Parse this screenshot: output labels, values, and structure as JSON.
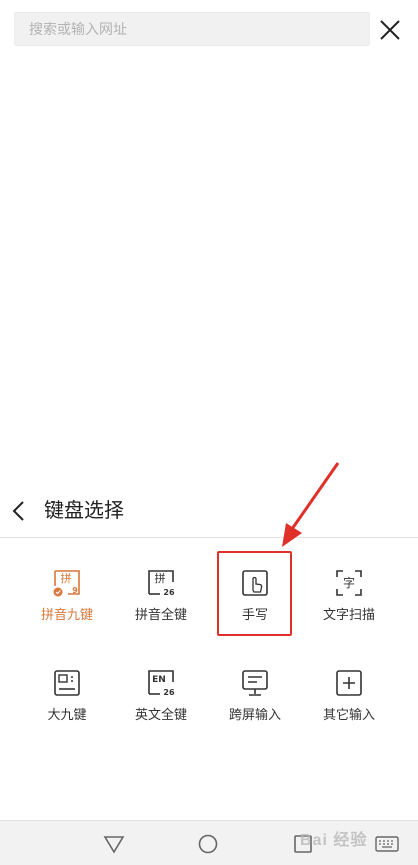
{
  "search": {
    "placeholder": "搜索或输入网址"
  },
  "panel": {
    "title": "键盘选择"
  },
  "keyboards": [
    {
      "label": "拼音九键",
      "icon": "pinyin-nine-key-icon",
      "selected": true
    },
    {
      "label": "拼音全键",
      "icon": "pinyin-full-key-icon",
      "selected": false
    },
    {
      "label": "手写",
      "icon": "handwriting-icon",
      "selected": false
    },
    {
      "label": "文字扫描",
      "icon": "text-scan-icon",
      "selected": false
    },
    {
      "label": "大九键",
      "icon": "big-nine-key-icon",
      "selected": false
    },
    {
      "label": "英文全键",
      "icon": "english-full-key-icon",
      "selected": false
    },
    {
      "label": "跨屏输入",
      "icon": "cross-screen-icon",
      "selected": false
    },
    {
      "label": "其它输入",
      "icon": "other-input-icon",
      "selected": false
    }
  ],
  "icon_text": {
    "pin": "拼",
    "nine": "9",
    "twenty_six": "26",
    "zi": "字",
    "en": "EN"
  },
  "watermark": "Bai 经验",
  "colors": {
    "accent": "#d9773a",
    "highlight": "#e0302a",
    "text": "#333333"
  }
}
